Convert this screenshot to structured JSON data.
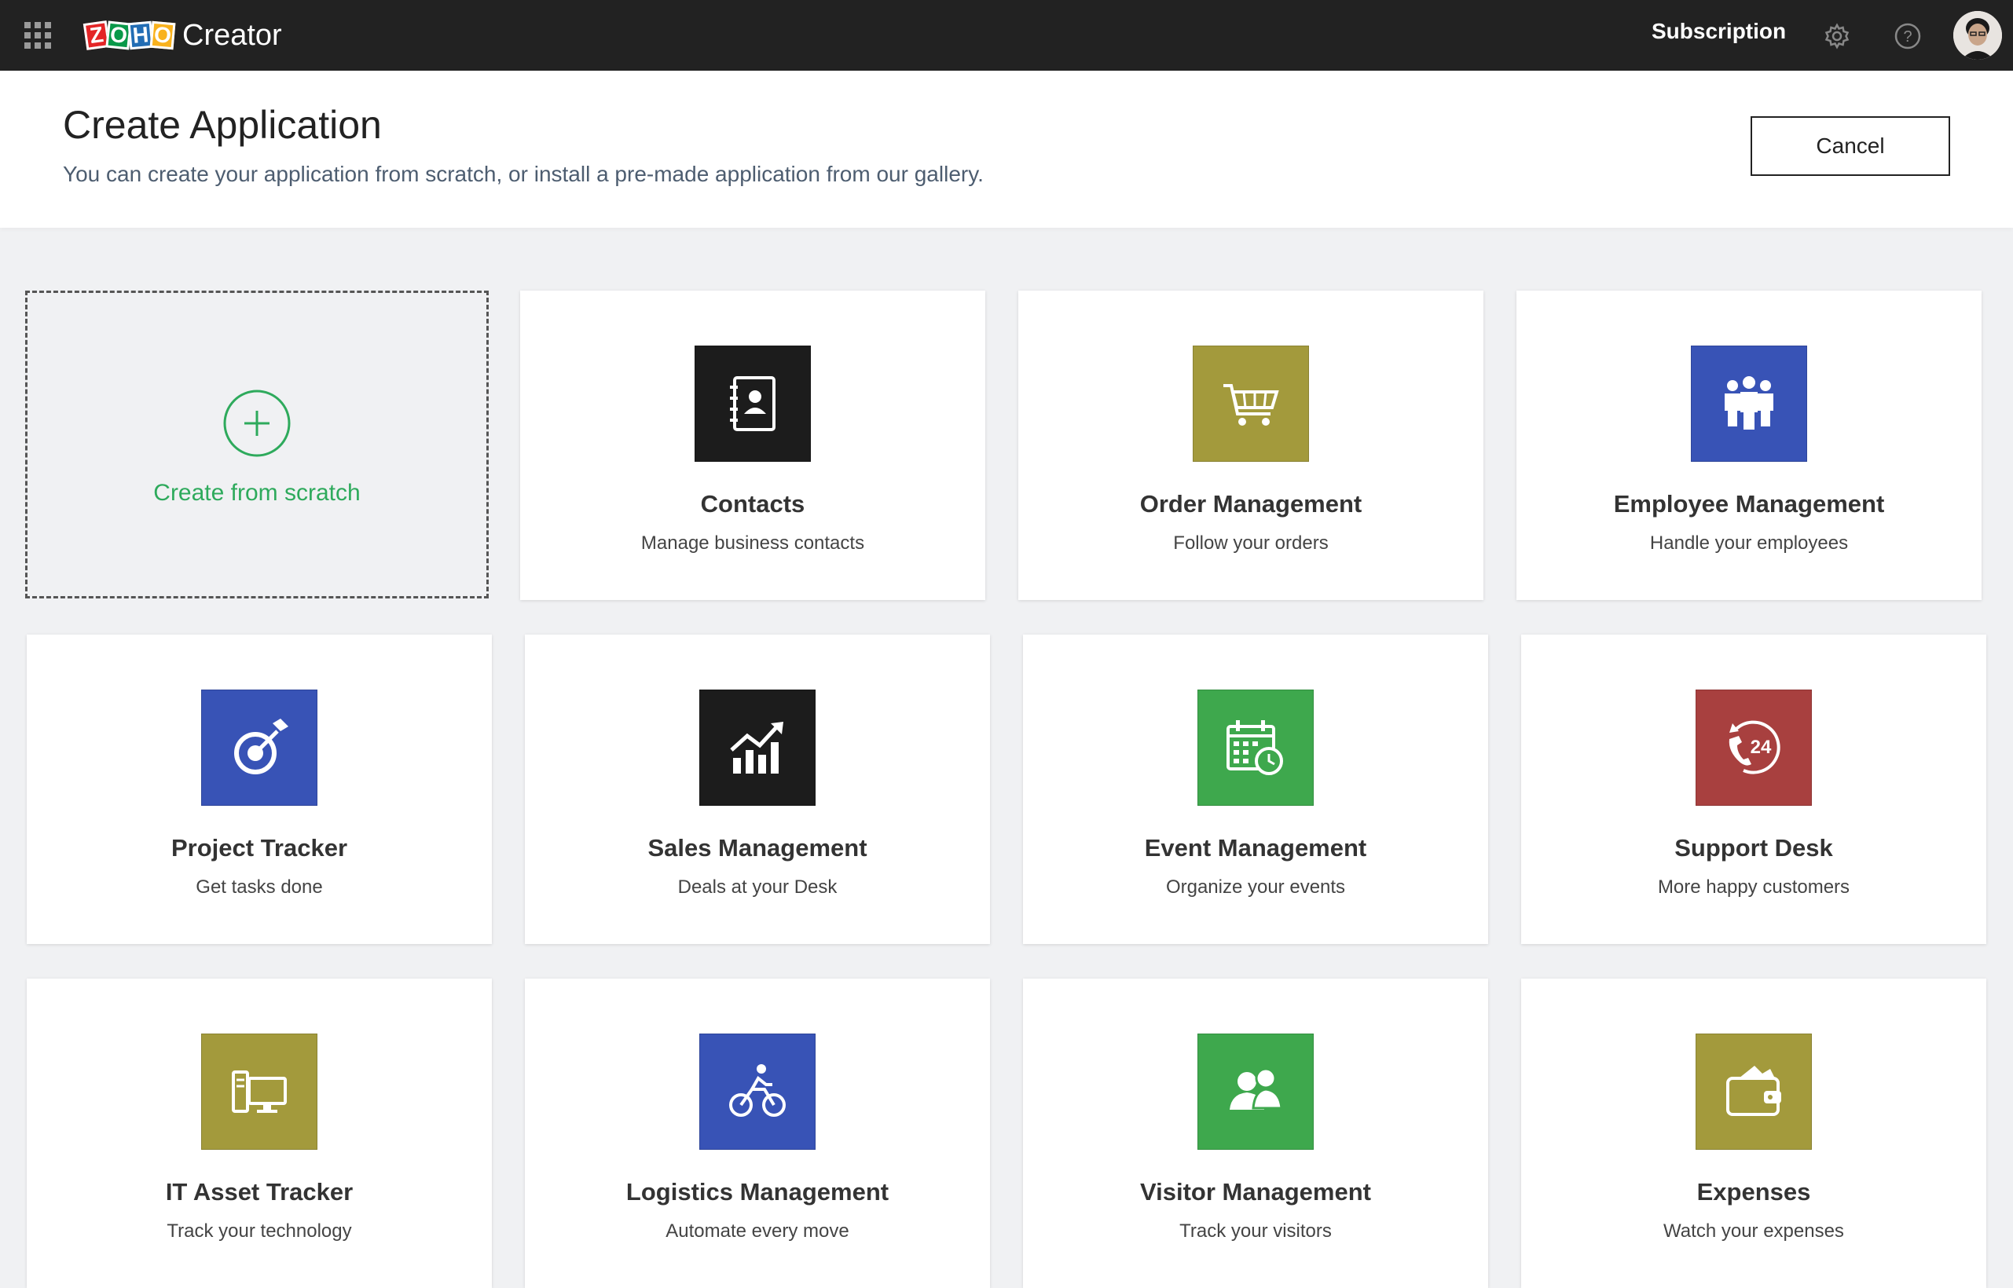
{
  "topbar": {
    "logo_letters": [
      "Z",
      "O",
      "H",
      "O"
    ],
    "logo_text": "Creator",
    "subscription": "Subscription"
  },
  "header": {
    "title": "Create Application",
    "subtitle": "You can create your application from scratch, or install a pre-made application from our gallery.",
    "cancel_label": "Cancel"
  },
  "scratch": {
    "label": "Create from scratch",
    "color": "#2eaa5c"
  },
  "apps": [
    {
      "name": "Contacts",
      "desc": "Manage business contacts",
      "color": "#1c1c1c",
      "icon": "contact-book-icon"
    },
    {
      "name": "Order Management",
      "desc": "Follow your orders",
      "color": "#a39a3c",
      "icon": "shopping-cart-icon"
    },
    {
      "name": "Employee Management",
      "desc": "Handle your employees",
      "color": "#3853b6",
      "icon": "people-group-icon"
    },
    {
      "name": "Project Tracker",
      "desc": "Get tasks done",
      "color": "#3853b6",
      "icon": "target-icon"
    },
    {
      "name": "Sales Management",
      "desc": "Deals at your Desk",
      "color": "#1c1c1c",
      "icon": "sales-chart-icon"
    },
    {
      "name": "Event Management",
      "desc": "Organize your events",
      "color": "#3ea84d",
      "icon": "calendar-clock-icon"
    },
    {
      "name": "Support Desk",
      "desc": "More happy customers",
      "color": "#a8403f",
      "icon": "support-24-icon"
    },
    {
      "name": "IT Asset Tracker",
      "desc": "Track your technology",
      "color": "#a39a3c",
      "icon": "computer-icon"
    },
    {
      "name": "Logistics Management",
      "desc": "Automate every move",
      "color": "#3853b6",
      "icon": "cyclist-icon"
    },
    {
      "name": "Visitor Management",
      "desc": "Track your visitors",
      "color": "#3ea84d",
      "icon": "visitors-icon"
    },
    {
      "name": "Expenses",
      "desc": "Watch your expenses",
      "color": "#a39a3c",
      "icon": "wallet-icon"
    }
  ]
}
